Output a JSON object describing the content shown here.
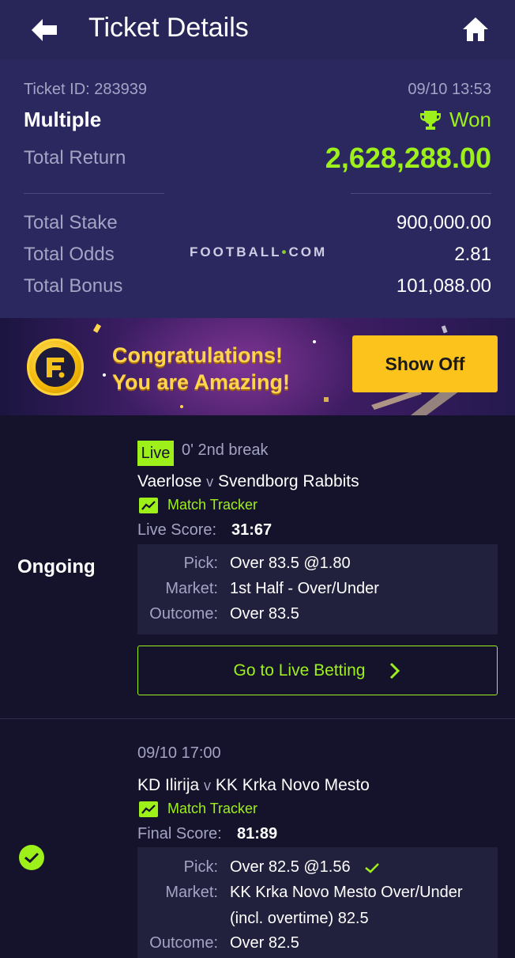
{
  "header": {
    "title": "Ticket Details",
    "back_icon": "arrow-left-icon",
    "home_icon": "home-icon"
  },
  "summary": {
    "ticket_id": "Ticket ID: 283939",
    "datetime": "09/10 13:53",
    "bet_type": "Multiple",
    "status": "Won",
    "total_return_label": "Total Return",
    "total_return_value": "2,628,288.00",
    "brand_left": "FOOTBALL",
    "brand_dot": "•",
    "brand_right": "COM",
    "rows": [
      {
        "label": "Total Stake",
        "value": "900,000.00"
      },
      {
        "label": "Total Odds",
        "value": "2.81"
      },
      {
        "label": "Total Bonus",
        "value": "101,088.00"
      }
    ]
  },
  "banner": {
    "line1": "Congratulations!",
    "line2": "You are Amazing!",
    "button": "Show Off"
  },
  "matches": [
    {
      "state": "Ongoing",
      "live_badge": "Live",
      "time_info": "0' 2nd break",
      "home": "Vaerlose",
      "vs": "v",
      "away": "Svendborg Rabbits",
      "tracker": "Match Tracker",
      "score_label": "Live Score:",
      "score": "31:67",
      "pick_label": "Pick:",
      "pick": "Over 83.5 @1.80",
      "market_label": "Market:",
      "market": "1st Half - Over/Under",
      "outcome_label": "Outcome:",
      "outcome": "Over 83.5",
      "cta": "Go to Live Betting"
    },
    {
      "datetime": "09/10 17:00",
      "home": "KD Ilirija",
      "vs": "v",
      "away": "KK Krka Novo Mesto",
      "tracker": "Match Tracker",
      "score_label": "Final Score:",
      "score": "81:89",
      "pick_label": "Pick:",
      "pick": "Over 82.5 @1.56",
      "market_label": "Market:",
      "market_line1": "KK Krka Novo Mesto Over/Under",
      "market_line2": "(incl. overtime) 82.5",
      "outcome_label": "Outcome:",
      "outcome": "Over 82.5"
    }
  ],
  "colors": {
    "accent_green": "#9ef01a",
    "header_bg": "#282659",
    "summary_bg": "#2b2860",
    "page_bg": "#14132b",
    "button_yellow": "#fcc31d"
  }
}
